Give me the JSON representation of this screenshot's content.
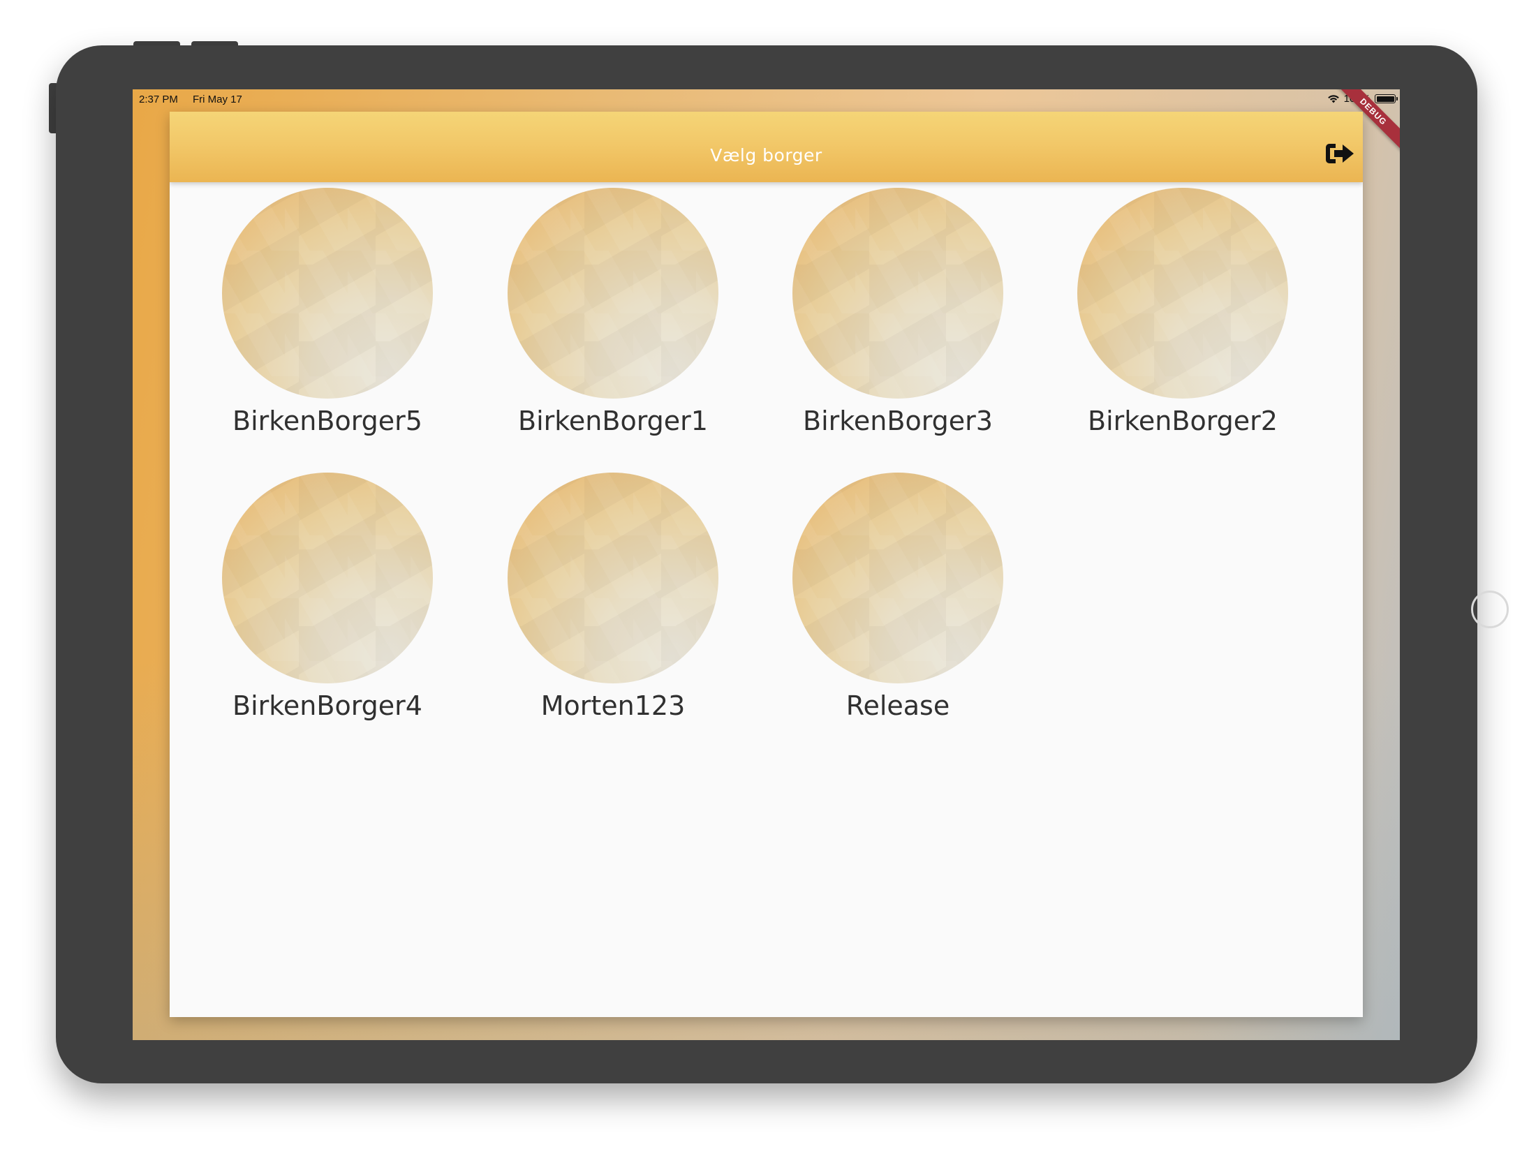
{
  "status_bar": {
    "time": "2:37 PM",
    "date": "Fri May 17",
    "battery": "100%"
  },
  "debug_banner": "DEBUG",
  "app_bar": {
    "title": "Vælg borger",
    "logout_icon": "logout-icon"
  },
  "citizens": [
    {
      "name": "BirkenBorger5"
    },
    {
      "name": "BirkenBorger1"
    },
    {
      "name": "BirkenBorger3"
    },
    {
      "name": "BirkenBorger2"
    },
    {
      "name": "BirkenBorger4"
    },
    {
      "name": "Morten123"
    },
    {
      "name": "Release"
    }
  ]
}
